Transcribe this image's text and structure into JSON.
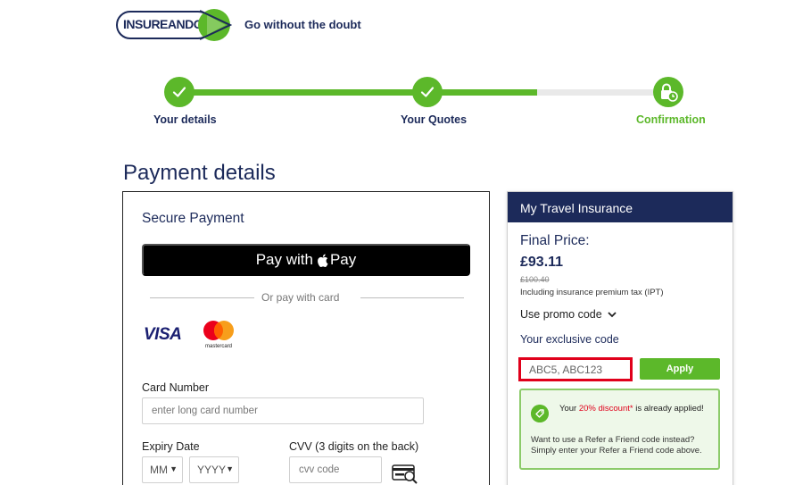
{
  "header": {
    "logo_text_a": "INSUREAND",
    "logo_text_b": "GO",
    "tagline": "Go without the doubt"
  },
  "progress": {
    "completed_fraction": 0.73,
    "steps": [
      {
        "label": "Your details",
        "status": "complete",
        "icon": "check-icon"
      },
      {
        "label": "Your Quotes",
        "status": "complete",
        "icon": "check-icon"
      },
      {
        "label": "Confirmation",
        "status": "current",
        "icon": "lock-clock-icon"
      }
    ]
  },
  "page_title": "Payment details",
  "payment": {
    "title": "Secure Payment",
    "apple_pay_prefix": "Pay with",
    "apple_pay_suffix": "Pay",
    "divider_text": "Or pay with card",
    "card_brands": [
      "VISA",
      "mastercard"
    ],
    "card_number_label": "Card Number",
    "card_number_placeholder": "enter long card number",
    "expiry_label": "Expiry Date",
    "expiry_month": "MM",
    "expiry_year": "YYYY",
    "cvv_label": "CVV (3 digits on the back)",
    "cvv_placeholder": "cvv code"
  },
  "summary": {
    "header": "My Travel Insurance",
    "final_price_label": "Final Price:",
    "final_price": "£93.11",
    "old_price": "£100.40",
    "ipt_note": "Including insurance premium tax (IPT)",
    "promo_toggle": "Use promo code",
    "exclusive_label": "Your exclusive code",
    "code_value": "ABC5, ABC123",
    "apply_label": "Apply",
    "discount_pre": "Your ",
    "discount_highlight": "20% discount*",
    "discount_post": " is already applied!",
    "refer_msg": "Want to use a Refer a Friend code instead? Simply enter your Refer a Friend code above."
  },
  "colors": {
    "navy": "#1c2a5a",
    "green": "#5cb82a",
    "red": "#e0001b"
  }
}
